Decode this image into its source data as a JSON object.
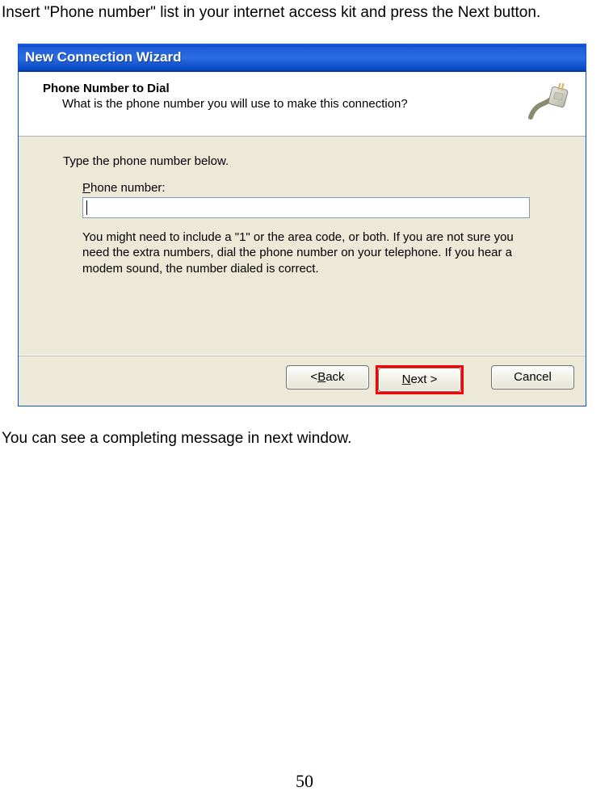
{
  "doc": {
    "intro_text": "Insert \"Phone number\" list in your internet access kit and press the Next button.",
    "outro_text": "You can see a completing message in next window.",
    "page_number": "50"
  },
  "wizard": {
    "title": "New Connection Wizard",
    "header": {
      "title": "Phone Number to Dial",
      "subtitle": "What is the phone number you will use to make this connection?"
    },
    "body": {
      "instruction": "Type the phone number below.",
      "field_label_prefix": "P",
      "field_label_rest": "hone number:",
      "phone_value": "",
      "hint": "You might need to include a \"1\" or the area code, or both. If you are not sure you need the extra numbers, dial the phone number on your telephone. If you hear a modem sound, the number dialed is correct."
    },
    "footer": {
      "back_prefix": "< ",
      "back_m": "B",
      "back_rest": "ack",
      "next_m": "N",
      "next_rest": "ext >",
      "cancel": "Cancel"
    }
  }
}
